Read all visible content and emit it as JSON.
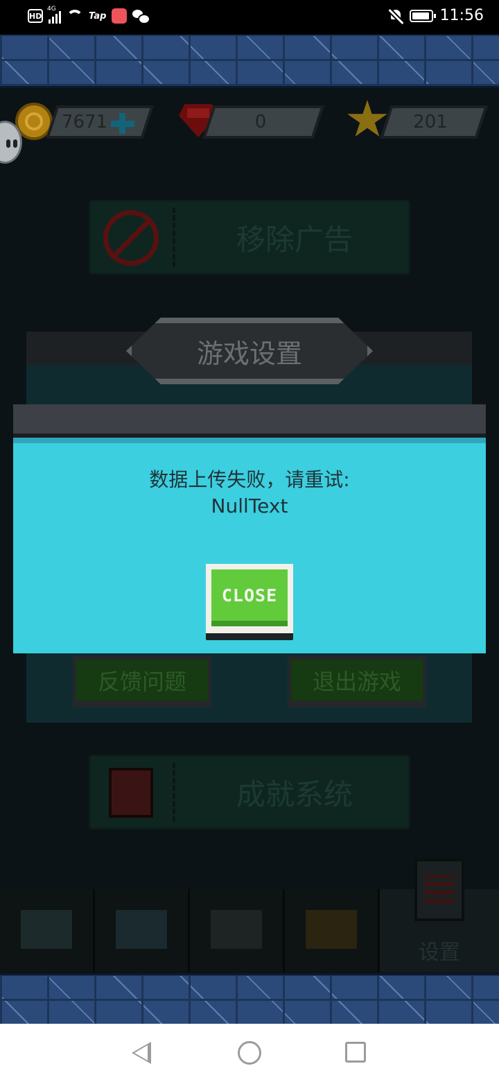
{
  "status_bar": {
    "hd_label": "HD",
    "network_label": "4G",
    "tap_label": "Tap",
    "time": "11:56"
  },
  "currencies": {
    "coins": "7671",
    "gems": "0",
    "stars": "201"
  },
  "menu": {
    "remove_ads": "移除广告",
    "achievements": "成就系统"
  },
  "settings_dialog": {
    "title": "游戏设置",
    "feedback_button": "反馈问题",
    "exit_button": "退出游戏"
  },
  "error_dialog": {
    "message_line1": "数据上传失败，请重试:",
    "message_line2": "NullText",
    "close_label": "CLOSE"
  },
  "tabs": {
    "settings_label": "设置"
  },
  "colors": {
    "dialog_body": "#3ccfe0",
    "dialog_header": "#3d4147",
    "close_button": "#62cb3c"
  }
}
